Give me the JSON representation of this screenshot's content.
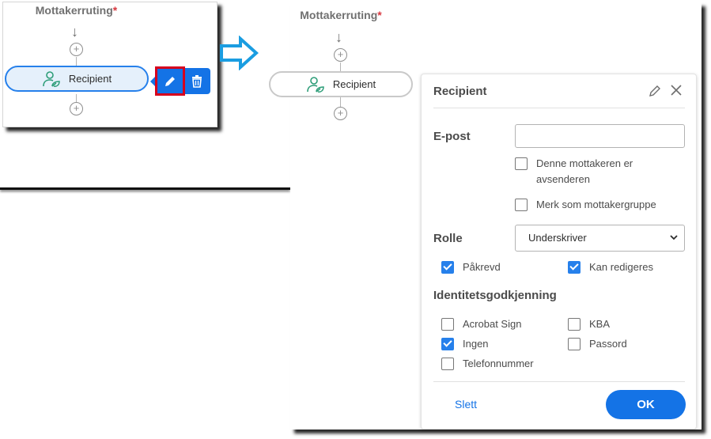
{
  "before": {
    "title": "Mottakerruting",
    "required_mark": "*",
    "node_label": "Recipient",
    "actions": {
      "edit_icon": "pencil-icon",
      "delete_icon": "trash-icon"
    }
  },
  "after": {
    "title": "Mottakerruting",
    "required_mark": "*",
    "node_label": "Recipient"
  },
  "panel": {
    "title": "Recipient",
    "email_label": "E-post",
    "email_value": "",
    "sender_checkbox_line1": "Denne mottakeren er",
    "sender_checkbox_line2": "avsenderen",
    "sender_checked": false,
    "group_checkbox": "Merk som mottakergruppe",
    "group_checked": false,
    "role_label": "Rolle",
    "role_value": "Underskriver",
    "required_checkbox": "Påkrevd",
    "required_checked": true,
    "editable_checkbox": "Kan redigeres",
    "editable_checked": true,
    "identity_label": "Identitetsgodkjenning",
    "auth_options": [
      {
        "label": "Acrobat Sign",
        "checked": false
      },
      {
        "label": "KBA",
        "checked": false
      },
      {
        "label": "Ingen",
        "checked": true
      },
      {
        "label": "Passord",
        "checked": false
      },
      {
        "label": "Telefonnummer",
        "checked": false
      }
    ],
    "delete_label": "Slett",
    "ok_label": "OK"
  },
  "colors": {
    "accent": "#1473e6",
    "required": "#d7373f",
    "highlight": "#d7001d",
    "icon_green": "#2d9d78"
  }
}
